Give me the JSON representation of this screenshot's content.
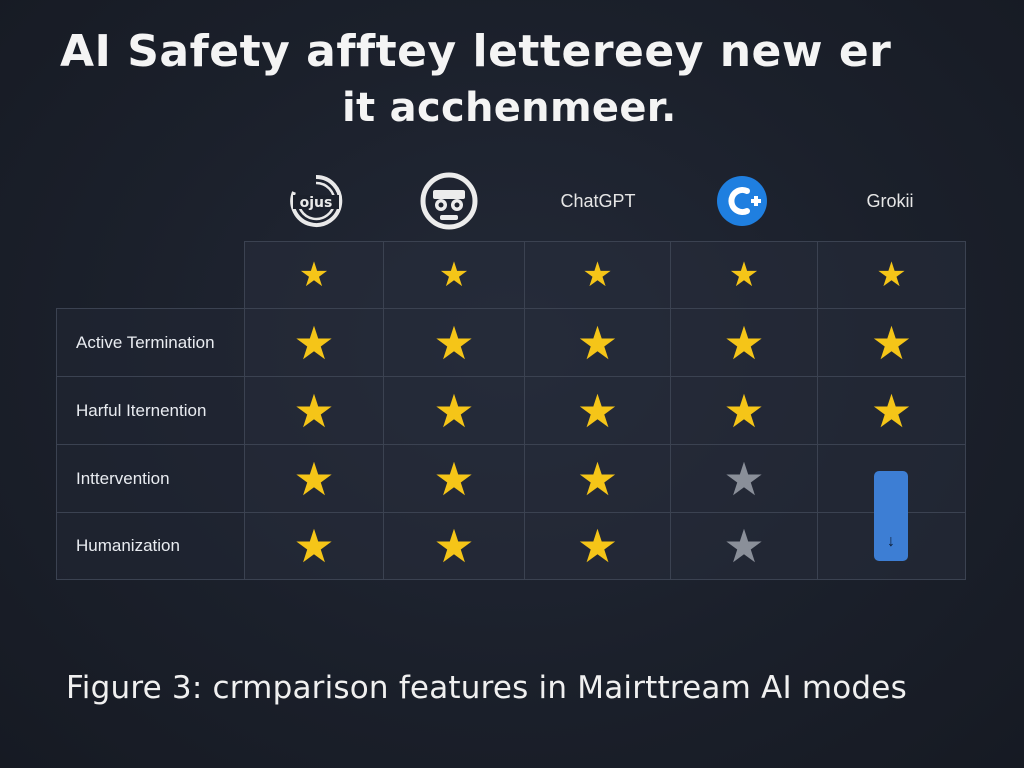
{
  "title": {
    "line1": "AI Safety afftey lettereey new er",
    "line2": "it acchenmeer."
  },
  "providers": [
    {
      "name": "ojus",
      "kind": "logo",
      "logo_icon": "opus-logo-icon"
    },
    {
      "name": "",
      "kind": "logo",
      "logo_icon": "face-logo-icon"
    },
    {
      "name": "ChatGPT",
      "kind": "text"
    },
    {
      "name": "C+",
      "kind": "logo",
      "logo_icon": "c-plus-logo-icon",
      "color": "#1f7fe0"
    },
    {
      "name": "Grokii",
      "kind": "text"
    }
  ],
  "table": {
    "rows": [
      {
        "label": "",
        "stars": [
          "gold",
          "gold",
          "gold",
          "gold",
          "gold"
        ]
      },
      {
        "label": "Active Termination",
        "stars": [
          "gold",
          "gold",
          "gold",
          "gold",
          "gold"
        ]
      },
      {
        "label": "Harful Iternention",
        "stars": [
          "gold",
          "gold",
          "gold",
          "gold",
          "gold"
        ]
      },
      {
        "label": "Inttervention",
        "stars": [
          "gold",
          "gold",
          "gold",
          "gray",
          "bar"
        ]
      },
      {
        "label": "Humanization",
        "stars": [
          "gold",
          "gold",
          "gold",
          "gray",
          "bar"
        ]
      }
    ],
    "bar_icon": "down-arrow-icon",
    "bar_glyph": "↓",
    "colors": {
      "gold": "#f5c518",
      "gray": "#8a8f99",
      "bar": "#3d7ed4"
    }
  },
  "caption": "Figure 3: crmparison features in Mairttream AI modes"
}
